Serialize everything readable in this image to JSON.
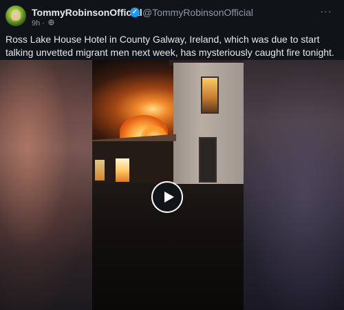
{
  "post": {
    "author_name": "TommyRobinsonOfficial",
    "author_handle": "@TommyRobinsonOfficial",
    "time": "9h",
    "separator": "·",
    "more_menu": "···",
    "text": "Ross Lake House Hotel in County Galway, Ireland, which was due to start talking unvetted migrant men next week, has mysteriously caught fire tonight."
  },
  "icons": {
    "verified": "verified-badge-icon",
    "audience": "globe-icon",
    "more": "more-icon",
    "play": "play-icon"
  },
  "colors": {
    "background": "#101418",
    "text_primary": "#e7e9ea",
    "text_secondary": "#8b98a5",
    "verified_blue": "#1d9bf0"
  }
}
